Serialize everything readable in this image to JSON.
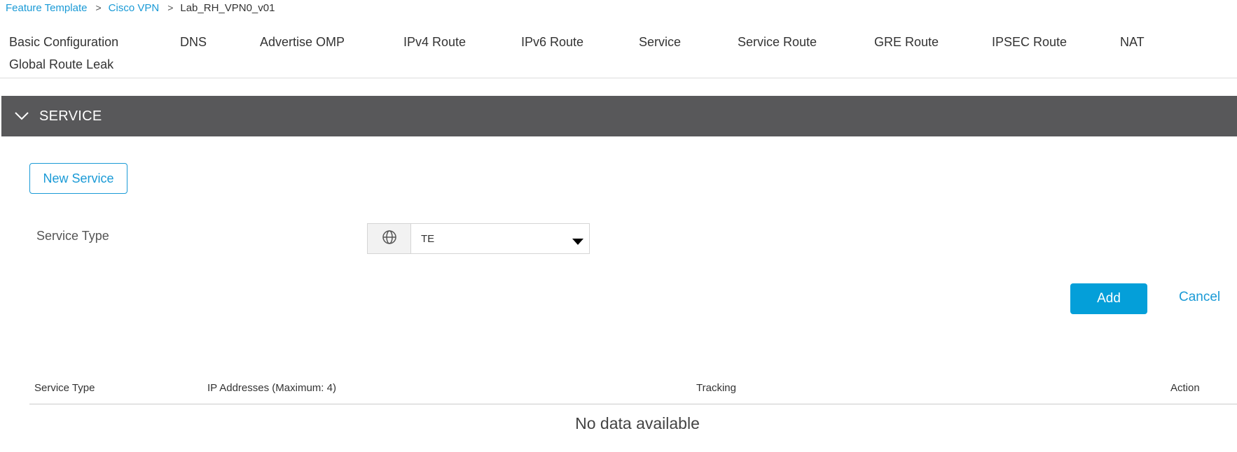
{
  "breadcrumb": {
    "items": [
      "Feature Template",
      "Cisco VPN"
    ],
    "current": "Lab_RH_VPN0_v01"
  },
  "tabs": [
    "Basic Configuration",
    "DNS",
    "Advertise OMP",
    "IPv4 Route",
    "IPv6 Route",
    "Service",
    "Service Route",
    "GRE Route",
    "IPSEC Route",
    "NAT",
    "Global Route Leak"
  ],
  "section": {
    "title": "SERVICE"
  },
  "form": {
    "new_service_label": "New Service",
    "service_type_label": "Service Type",
    "service_type_value": "TE",
    "scope_icon": "globe-icon",
    "add_label": "Add",
    "cancel_label": "Cancel"
  },
  "table": {
    "headers": [
      "Service Type",
      "IP Addresses (Maximum: 4)",
      "Tracking",
      "Action"
    ],
    "empty_text": "No data available"
  },
  "colors": {
    "accent": "#1a9ad6",
    "primary_button": "#049fd9",
    "section_header": "#58585a"
  }
}
